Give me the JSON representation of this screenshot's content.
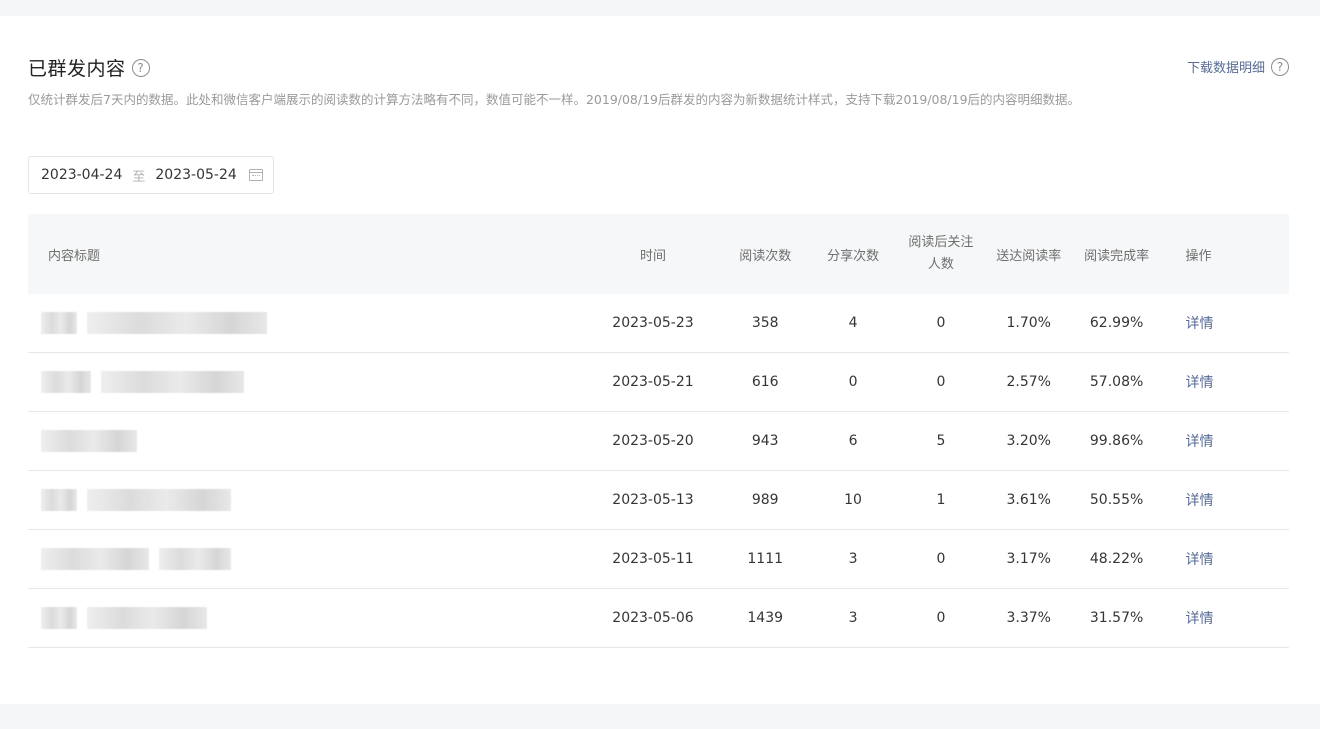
{
  "header": {
    "title": "已群发内容",
    "help_glyph": "?",
    "download_label": "下载数据明细",
    "description": "仅统计群发后7天内的数据。此处和微信客户端展示的阅读数的计算方法略有不同，数值可能不一样。2019/08/19后群发的内容为新数据统计样式，支持下载2019/08/19后的内容明细数据。"
  },
  "date_range": {
    "start": "2023-04-24",
    "separator": "至",
    "end": "2023-05-24"
  },
  "table": {
    "columns": {
      "title": "内容标题",
      "time": "时间",
      "reads": "阅读次数",
      "shares": "分享次数",
      "follows": "阅读后关注人数",
      "delivery_rate": "送达阅读率",
      "completion_rate": "阅读完成率",
      "action": "操作"
    },
    "rows": [
      {
        "time": "2023-05-23",
        "reads": "358",
        "shares": "4",
        "follows": "0",
        "delivery_rate": "1.70%",
        "completion_rate": "62.99%",
        "action": "详情"
      },
      {
        "time": "2023-05-21",
        "reads": "616",
        "shares": "0",
        "follows": "0",
        "delivery_rate": "2.57%",
        "completion_rate": "57.08%",
        "action": "详情"
      },
      {
        "time": "2023-05-20",
        "reads": "943",
        "shares": "6",
        "follows": "5",
        "delivery_rate": "3.20%",
        "completion_rate": "99.86%",
        "action": "详情"
      },
      {
        "time": "2023-05-13",
        "reads": "989",
        "shares": "10",
        "follows": "1",
        "delivery_rate": "3.61%",
        "completion_rate": "50.55%",
        "action": "详情"
      },
      {
        "time": "2023-05-11",
        "reads": "1111",
        "shares": "3",
        "follows": "0",
        "delivery_rate": "3.17%",
        "completion_rate": "48.22%",
        "action": "详情"
      },
      {
        "time": "2023-05-06",
        "reads": "1439",
        "shares": "3",
        "follows": "0",
        "delivery_rate": "3.37%",
        "completion_rate": "31.57%",
        "action": "详情"
      }
    ]
  },
  "colors": {
    "link": "#576b95",
    "muted_text": "#9a9a9a",
    "header_bg": "#f6f7f8"
  }
}
